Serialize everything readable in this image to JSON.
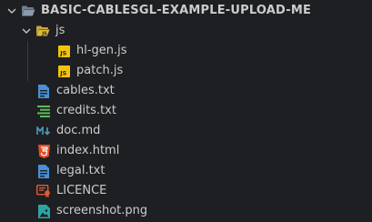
{
  "explorer": {
    "root": {
      "label": "BASIC-CABLESGL-EXAMPLE-UPLOAD-ME",
      "icon": "chevron-down-icon",
      "expanded": true
    },
    "folder_js": {
      "label": "js",
      "icon": "folder-js-icon",
      "expanded": true
    },
    "js_files": [
      {
        "label": "hl-gen.js",
        "icon": "javascript-file-icon"
      },
      {
        "label": "patch.js",
        "icon": "javascript-file-icon"
      }
    ],
    "files": [
      {
        "label": "cables.txt",
        "icon": "text-file-icon"
      },
      {
        "label": "credits.txt",
        "icon": "lines-file-icon"
      },
      {
        "label": "doc.md",
        "icon": "markdown-file-icon"
      },
      {
        "label": "index.html",
        "icon": "html-file-icon"
      },
      {
        "label": "legal.txt",
        "icon": "text-file-icon"
      },
      {
        "label": "LICENCE",
        "icon": "license-file-icon"
      },
      {
        "label": "screenshot.png",
        "icon": "image-file-icon"
      }
    ],
    "colors": {
      "background": "#1e1f22",
      "text": "#cccccc",
      "folder": "#7e8ea0",
      "js_badge": "#f1c40f",
      "text_file": "#4a8fd8",
      "credits_file": "#5cb85c",
      "markdown_file": "#519aba",
      "html_file": "#e44d26",
      "license_file": "#e25a3a",
      "image_file": "#2fa4a4"
    }
  }
}
